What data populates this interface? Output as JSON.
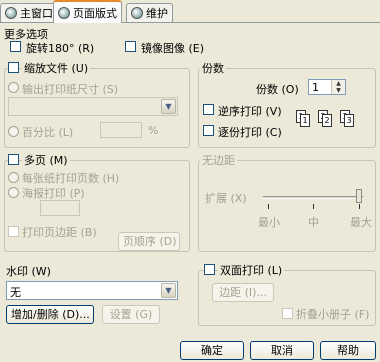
{
  "tabs": [
    {
      "label": "主窗口"
    },
    {
      "label": "页面版式"
    },
    {
      "label": "维护"
    }
  ],
  "more_options": {
    "title": "更多选项",
    "rotate_label": "旋转180° (R)",
    "mirror_label": "镜像图像 (E)"
  },
  "scale_group": {
    "title": "缩放文件 (U)",
    "output_size_label": "输出打印纸尺寸 (S)",
    "percent_label": "百分比 (L)",
    "percent_unit": "%"
  },
  "copies_group": {
    "title": "份数",
    "copies_label": "份数 (O)",
    "copies_value": "1",
    "reverse_label": "逆序打印 (V)",
    "collate_label": "逐份打印 (C)"
  },
  "multi_page": {
    "title": "多页 (M)",
    "pages_per_sheet_label": "每张纸打印页数 (H)",
    "poster_label": "海报打印 (P)",
    "border_label": "打印页边距 (B)",
    "page_order_button": "页顺序 (D)"
  },
  "no_margin": {
    "title": "无边距",
    "expand_label": "扩展 (X)",
    "ticks": [
      "最小",
      "中",
      "最大"
    ]
  },
  "watermark": {
    "title": "水印 (W)",
    "selected": "无",
    "add_delete_button": "增加/删除 (D)...",
    "settings_button": "设置 (G)"
  },
  "duplex": {
    "title": "双面打印 (L)",
    "margin_button": "边距 (I)...",
    "booklet_label": "折叠小册子 (F)"
  },
  "footer": {
    "ok": "确定",
    "cancel": "取消",
    "help": "帮助"
  }
}
